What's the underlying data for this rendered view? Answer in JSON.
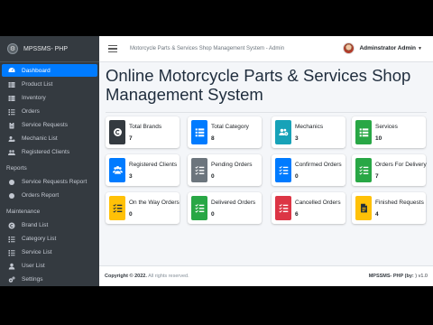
{
  "sidebar": {
    "brand": "MPSSMS- PHP",
    "items": [
      {
        "label": "Dashboard",
        "icon": "dashboard-icon"
      },
      {
        "label": "Product List",
        "icon": "table-icon"
      },
      {
        "label": "Inventory",
        "icon": "table-icon"
      },
      {
        "label": "Orders",
        "icon": "list-icon"
      },
      {
        "label": "Service Requests",
        "icon": "clipboard-icon"
      },
      {
        "label": "Mechanic List",
        "icon": "users-cog-icon"
      },
      {
        "label": "Registered Clients",
        "icon": "users-icon"
      }
    ],
    "reports_header": "Reports",
    "reports": [
      {
        "label": "Service Requests Report",
        "icon": "circle-icon"
      },
      {
        "label": "Orders Report",
        "icon": "circle-icon"
      }
    ],
    "maintenance_header": "Maintenance",
    "maintenance": [
      {
        "label": "Brand List",
        "icon": "copyright-icon"
      },
      {
        "label": "Category List",
        "icon": "list-icon"
      },
      {
        "label": "Service List",
        "icon": "list-icon"
      },
      {
        "label": "User List",
        "icon": "user-icon"
      },
      {
        "label": "Settings",
        "icon": "gears-icon"
      }
    ]
  },
  "topbar": {
    "title": "Motorcycle Parts & Services Shop Management System - Admin",
    "user_name": "Adminstrator Admin"
  },
  "page": {
    "title": "Online Motorcycle Parts & Services Shop Management System"
  },
  "cards": [
    {
      "label": "Total Brands",
      "value": "7",
      "icon": "copyright-icon",
      "color": "#343a40"
    },
    {
      "label": "Total Category",
      "value": "8",
      "icon": "th-list-icon",
      "color": "#007bff"
    },
    {
      "label": "Mechanics",
      "value": "3",
      "icon": "users-cog-icon",
      "color": "#17a2b8"
    },
    {
      "label": "Services",
      "value": "10",
      "icon": "th-list-icon",
      "color": "#28a745"
    },
    {
      "label": "Registered Clients",
      "value": "3",
      "icon": "users-icon",
      "color": "#007bff"
    },
    {
      "label": "Pending Orders",
      "value": "0",
      "icon": "tasks-icon",
      "color": "#6c757d"
    },
    {
      "label": "Confirmed Orders",
      "value": "0",
      "icon": "tasks-icon",
      "color": "#007bff"
    },
    {
      "label": "Orders For Delivery",
      "value": "7",
      "icon": "tasks-icon",
      "color": "#28a745"
    },
    {
      "label": "On the Way Orders",
      "value": "0",
      "icon": "tasks-icon",
      "color": "#ffc107"
    },
    {
      "label": "Delivered Orders",
      "value": "0",
      "icon": "tasks-icon",
      "color": "#28a745"
    },
    {
      "label": "Cancelled Orders",
      "value": "6",
      "icon": "tasks-icon",
      "color": "#dc3545"
    },
    {
      "label": "Finished Requests",
      "value": "4",
      "icon": "file-invoice-icon",
      "color": "#ffc107"
    }
  ],
  "footer": {
    "copyright_prefix": "Copyright © 2022.",
    "rights": "All rights reserved.",
    "app_name": "MPSSMS- PHP (by: ",
    "version": ") v1.0"
  }
}
